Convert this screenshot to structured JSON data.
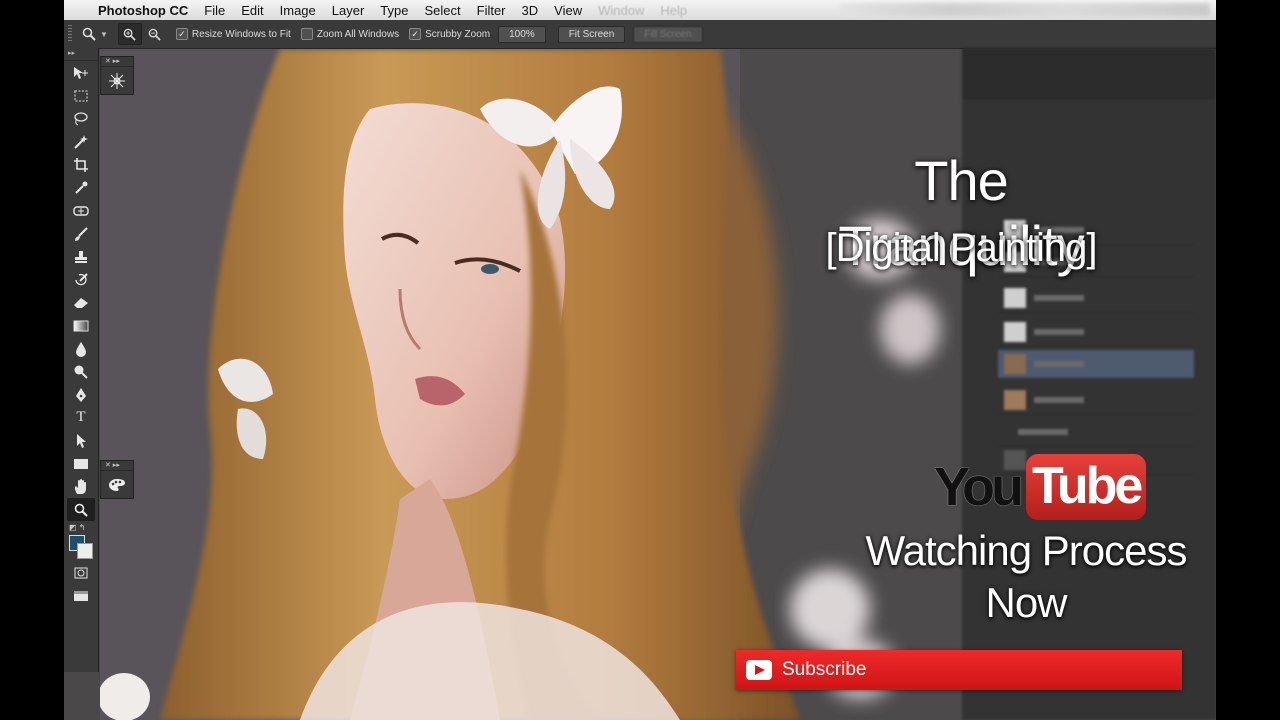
{
  "menubar": {
    "apple": "",
    "app": "Photoshop CC",
    "items": [
      "File",
      "Edit",
      "Image",
      "Layer",
      "Type",
      "Select",
      "Filter",
      "3D",
      "View",
      "Window",
      "Help"
    ]
  },
  "options": {
    "zoom_icon": "zoom-icon",
    "zoom_in_icon": "zoom-in-icon",
    "zoom_out_icon": "zoom-out-icon",
    "resize_windows": "Resize Windows to Fit",
    "zoom_all_windows": "Zoom All Windows",
    "scrubby_zoom": "Scrubby Zoom",
    "zoom_level": "100%",
    "fit_screen": "Fit Screen",
    "fill_screen": "Fill Screen",
    "resize_checked": true,
    "zoom_all_checked": false,
    "scrubby_checked": true
  },
  "tools": [
    "move",
    "marquee",
    "lasso",
    "magic-wand",
    "crop",
    "eyedropper",
    "spot-healing",
    "brush",
    "clone-stamp",
    "history-brush",
    "eraser",
    "gradient",
    "blur",
    "dodge",
    "pen",
    "type",
    "path-selection",
    "rectangle",
    "hand",
    "zoom"
  ],
  "overlay": {
    "title": "The Tranquility",
    "subtitle": "[Digital Painting]",
    "youtube_you": "You",
    "youtube_tube": "Tube",
    "watch_line1": "Watching Process",
    "watch_line2": "Now",
    "subscribe": "Subscribe"
  },
  "colors": {
    "foreground": "#1f4f6b",
    "background": "#eeeeee",
    "subscribe_red": "#e21f1f",
    "hair": "#b07a3c"
  }
}
